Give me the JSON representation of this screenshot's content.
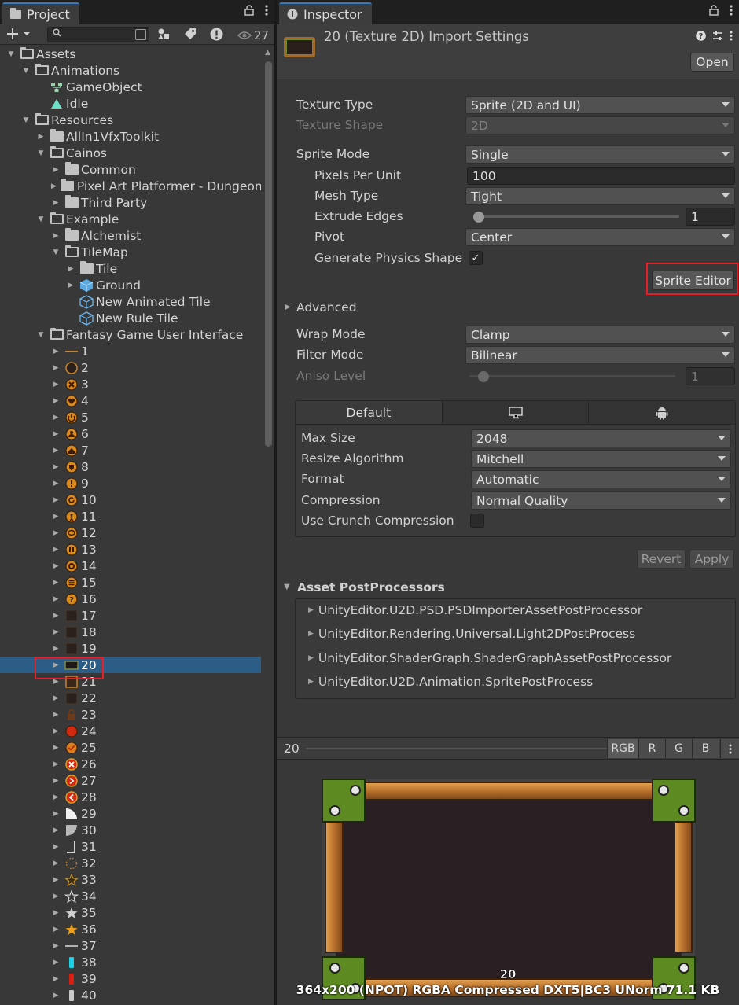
{
  "project": {
    "tab_label": "Project",
    "hidden_count": "27",
    "tree": [
      {
        "label": "Assets",
        "depth": 0,
        "icon": "folder-open",
        "arrow": "down"
      },
      {
        "label": "Animations",
        "depth": 1,
        "icon": "folder-open",
        "arrow": "down"
      },
      {
        "label": "GameObject",
        "depth": 2,
        "icon": "animator-icon",
        "arrow": ""
      },
      {
        "label": "Idle",
        "depth": 2,
        "icon": "animation-clip-icon",
        "arrow": ""
      },
      {
        "label": "Resources",
        "depth": 1,
        "icon": "folder-open",
        "arrow": "down"
      },
      {
        "label": "AllIn1VfxToolkit",
        "depth": 2,
        "icon": "folder",
        "arrow": "right"
      },
      {
        "label": "Cainos",
        "depth": 2,
        "icon": "folder-open",
        "arrow": "down"
      },
      {
        "label": "Common",
        "depth": 3,
        "icon": "folder",
        "arrow": "right"
      },
      {
        "label": "Pixel Art Platformer - Dungeon",
        "depth": 3,
        "icon": "folder",
        "arrow": "right"
      },
      {
        "label": "Third Party",
        "depth": 3,
        "icon": "folder",
        "arrow": "right"
      },
      {
        "label": "Example",
        "depth": 2,
        "icon": "folder-open",
        "arrow": "down"
      },
      {
        "label": "Alchemist",
        "depth": 3,
        "icon": "folder",
        "arrow": "right"
      },
      {
        "label": "TileMap",
        "depth": 3,
        "icon": "folder-open",
        "arrow": "down"
      },
      {
        "label": "Tile",
        "depth": 4,
        "icon": "folder",
        "arrow": "right"
      },
      {
        "label": "Ground",
        "depth": 4,
        "icon": "prefab-cube-icon",
        "arrow": "right"
      },
      {
        "label": "New Animated Tile",
        "depth": 4,
        "icon": "tile-asset-icon",
        "arrow": ""
      },
      {
        "label": "New Rule Tile",
        "depth": 4,
        "icon": "tile-asset-icon",
        "arrow": ""
      },
      {
        "label": "Fantasy Game User Interface",
        "depth": 2,
        "icon": "folder-open",
        "arrow": "down"
      },
      {
        "label": "1",
        "depth": 3,
        "icon": "sprite-bar",
        "arrow": "right"
      },
      {
        "label": "2",
        "depth": 3,
        "icon": "sprite-ring",
        "arrow": "right"
      },
      {
        "label": "3",
        "depth": 3,
        "icon": "sprite-x-orange",
        "arrow": "right"
      },
      {
        "label": "4",
        "depth": 3,
        "icon": "sprite-heart",
        "arrow": "right"
      },
      {
        "label": "5",
        "depth": 3,
        "icon": "sprite-power",
        "arrow": "right"
      },
      {
        "label": "6",
        "depth": 3,
        "icon": "sprite-person",
        "arrow": "right"
      },
      {
        "label": "7",
        "depth": 3,
        "icon": "sprite-home",
        "arrow": "right"
      },
      {
        "label": "8",
        "depth": 3,
        "icon": "sprite-trophy",
        "arrow": "right"
      },
      {
        "label": "9",
        "depth": 3,
        "icon": "sprite-exclaim",
        "arrow": "right"
      },
      {
        "label": "10",
        "depth": 3,
        "icon": "sprite-refresh",
        "arrow": "right"
      },
      {
        "label": "11",
        "depth": 3,
        "icon": "sprite-figure",
        "arrow": "right"
      },
      {
        "label": "12",
        "depth": 3,
        "icon": "sprite-chat",
        "arrow": "right"
      },
      {
        "label": "13",
        "depth": 3,
        "icon": "sprite-pause",
        "arrow": "right"
      },
      {
        "label": "14",
        "depth": 3,
        "icon": "sprite-gear",
        "arrow": "right"
      },
      {
        "label": "15",
        "depth": 3,
        "icon": "sprite-menu",
        "arrow": "right"
      },
      {
        "label": "16",
        "depth": 3,
        "icon": "sprite-question",
        "arrow": "right"
      },
      {
        "label": "17",
        "depth": 3,
        "icon": "sprite-dark-panel",
        "arrow": "right"
      },
      {
        "label": "18",
        "depth": 3,
        "icon": "sprite-dark-panel",
        "arrow": "right"
      },
      {
        "label": "19",
        "depth": 3,
        "icon": "sprite-dark-panel",
        "arrow": "right"
      },
      {
        "label": "20",
        "depth": 3,
        "icon": "sprite-frame",
        "arrow": "right",
        "selected": true
      },
      {
        "label": "21",
        "depth": 3,
        "icon": "sprite-brown-panel",
        "arrow": "right"
      },
      {
        "label": "22",
        "depth": 3,
        "icon": "sprite-dark-panel",
        "arrow": "right"
      },
      {
        "label": "23",
        "depth": 3,
        "icon": "sprite-lock",
        "arrow": "right"
      },
      {
        "label": "24",
        "depth": 3,
        "icon": "sprite-red-circle",
        "arrow": "right"
      },
      {
        "label": "25",
        "depth": 3,
        "icon": "sprite-check-circle",
        "arrow": "right"
      },
      {
        "label": "26",
        "depth": 3,
        "icon": "sprite-x-red",
        "arrow": "right"
      },
      {
        "label": "27",
        "depth": 3,
        "icon": "sprite-next",
        "arrow": "right"
      },
      {
        "label": "28",
        "depth": 3,
        "icon": "sprite-prev",
        "arrow": "right"
      },
      {
        "label": "29",
        "depth": 3,
        "icon": "sprite-quarter-white",
        "arrow": "right"
      },
      {
        "label": "30",
        "depth": 3,
        "icon": "sprite-quarter-grey",
        "arrow": "right"
      },
      {
        "label": "31",
        "depth": 3,
        "icon": "sprite-corner",
        "arrow": "right"
      },
      {
        "label": "32",
        "depth": 3,
        "icon": "sprite-dotted-ring",
        "arrow": "right"
      },
      {
        "label": "33",
        "depth": 3,
        "icon": "sprite-star-outline-gold",
        "arrow": "right"
      },
      {
        "label": "34",
        "depth": 3,
        "icon": "sprite-star-outline",
        "arrow": "right"
      },
      {
        "label": "35",
        "depth": 3,
        "icon": "sprite-star-grey",
        "arrow": "right"
      },
      {
        "label": "36",
        "depth": 3,
        "icon": "sprite-star-gold",
        "arrow": "right"
      },
      {
        "label": "37",
        "depth": 3,
        "icon": "sprite-line",
        "arrow": "right"
      },
      {
        "label": "38",
        "depth": 3,
        "icon": "sprite-cyan-bar",
        "arrow": "right"
      },
      {
        "label": "39",
        "depth": 3,
        "icon": "sprite-red-bar",
        "arrow": "right"
      },
      {
        "label": "40",
        "depth": 3,
        "icon": "sprite-grey-bar",
        "arrow": "right"
      }
    ]
  },
  "inspector": {
    "tab_label": "Inspector",
    "title": "20 (Texture 2D) Import Settings",
    "open_button": "Open",
    "texture_type": {
      "label": "Texture Type",
      "value": "Sprite (2D and UI)"
    },
    "texture_shape": {
      "label": "Texture Shape",
      "value": "2D"
    },
    "sprite_mode": {
      "label": "Sprite Mode",
      "value": "Single"
    },
    "pixels_per_unit": {
      "label": "Pixels Per Unit",
      "value": "100"
    },
    "mesh_type": {
      "label": "Mesh Type",
      "value": "Tight"
    },
    "extrude_edges": {
      "label": "Extrude Edges",
      "value": "1"
    },
    "pivot": {
      "label": "Pivot",
      "value": "Center"
    },
    "generate_physics_shape": {
      "label": "Generate Physics Shape",
      "checked": true,
      "check_glyph": "✓"
    },
    "sprite_editor_button": "Sprite Editor",
    "advanced_label": "Advanced",
    "wrap_mode": {
      "label": "Wrap Mode",
      "value": "Clamp"
    },
    "filter_mode": {
      "label": "Filter Mode",
      "value": "Bilinear"
    },
    "aniso_level": {
      "label": "Aniso Level",
      "value": "1"
    },
    "platform": {
      "tabs": [
        {
          "label": "Default"
        },
        {
          "label": ""
        },
        {
          "label": ""
        }
      ],
      "max_size": {
        "label": "Max Size",
        "value": "2048"
      },
      "resize_algorithm": {
        "label": "Resize Algorithm",
        "value": "Mitchell"
      },
      "format": {
        "label": "Format",
        "value": "Automatic"
      },
      "compression": {
        "label": "Compression",
        "value": "Normal Quality"
      },
      "use_crunch": {
        "label": "Use Crunch Compression",
        "checked": false
      }
    },
    "revert_button": "Revert",
    "apply_button": "Apply",
    "postprocessors": {
      "header": "Asset PostProcessors",
      "items": [
        "UnityEditor.U2D.PSD.PSDImporterAssetPostProcessor",
        "UnityEditor.Rendering.Universal.Light2DPostProcess",
        "UnityEditor.ShaderGraph.ShaderGraphAssetPostProcessor",
        "UnityEditor.U2D.Animation.SpritePostProcess"
      ]
    },
    "preview": {
      "name": "20",
      "channels": [
        "RGB",
        "R",
        "G",
        "B"
      ],
      "sprite_label": "20",
      "info": "364x200 (NPOT)  RGBA Compressed DXT5|BC3 UNorm   71.1 KB"
    }
  },
  "colors": {
    "selection": "#2c5d87",
    "highlight_box": "#e2202a",
    "accent_tab": "#3a79bb"
  }
}
